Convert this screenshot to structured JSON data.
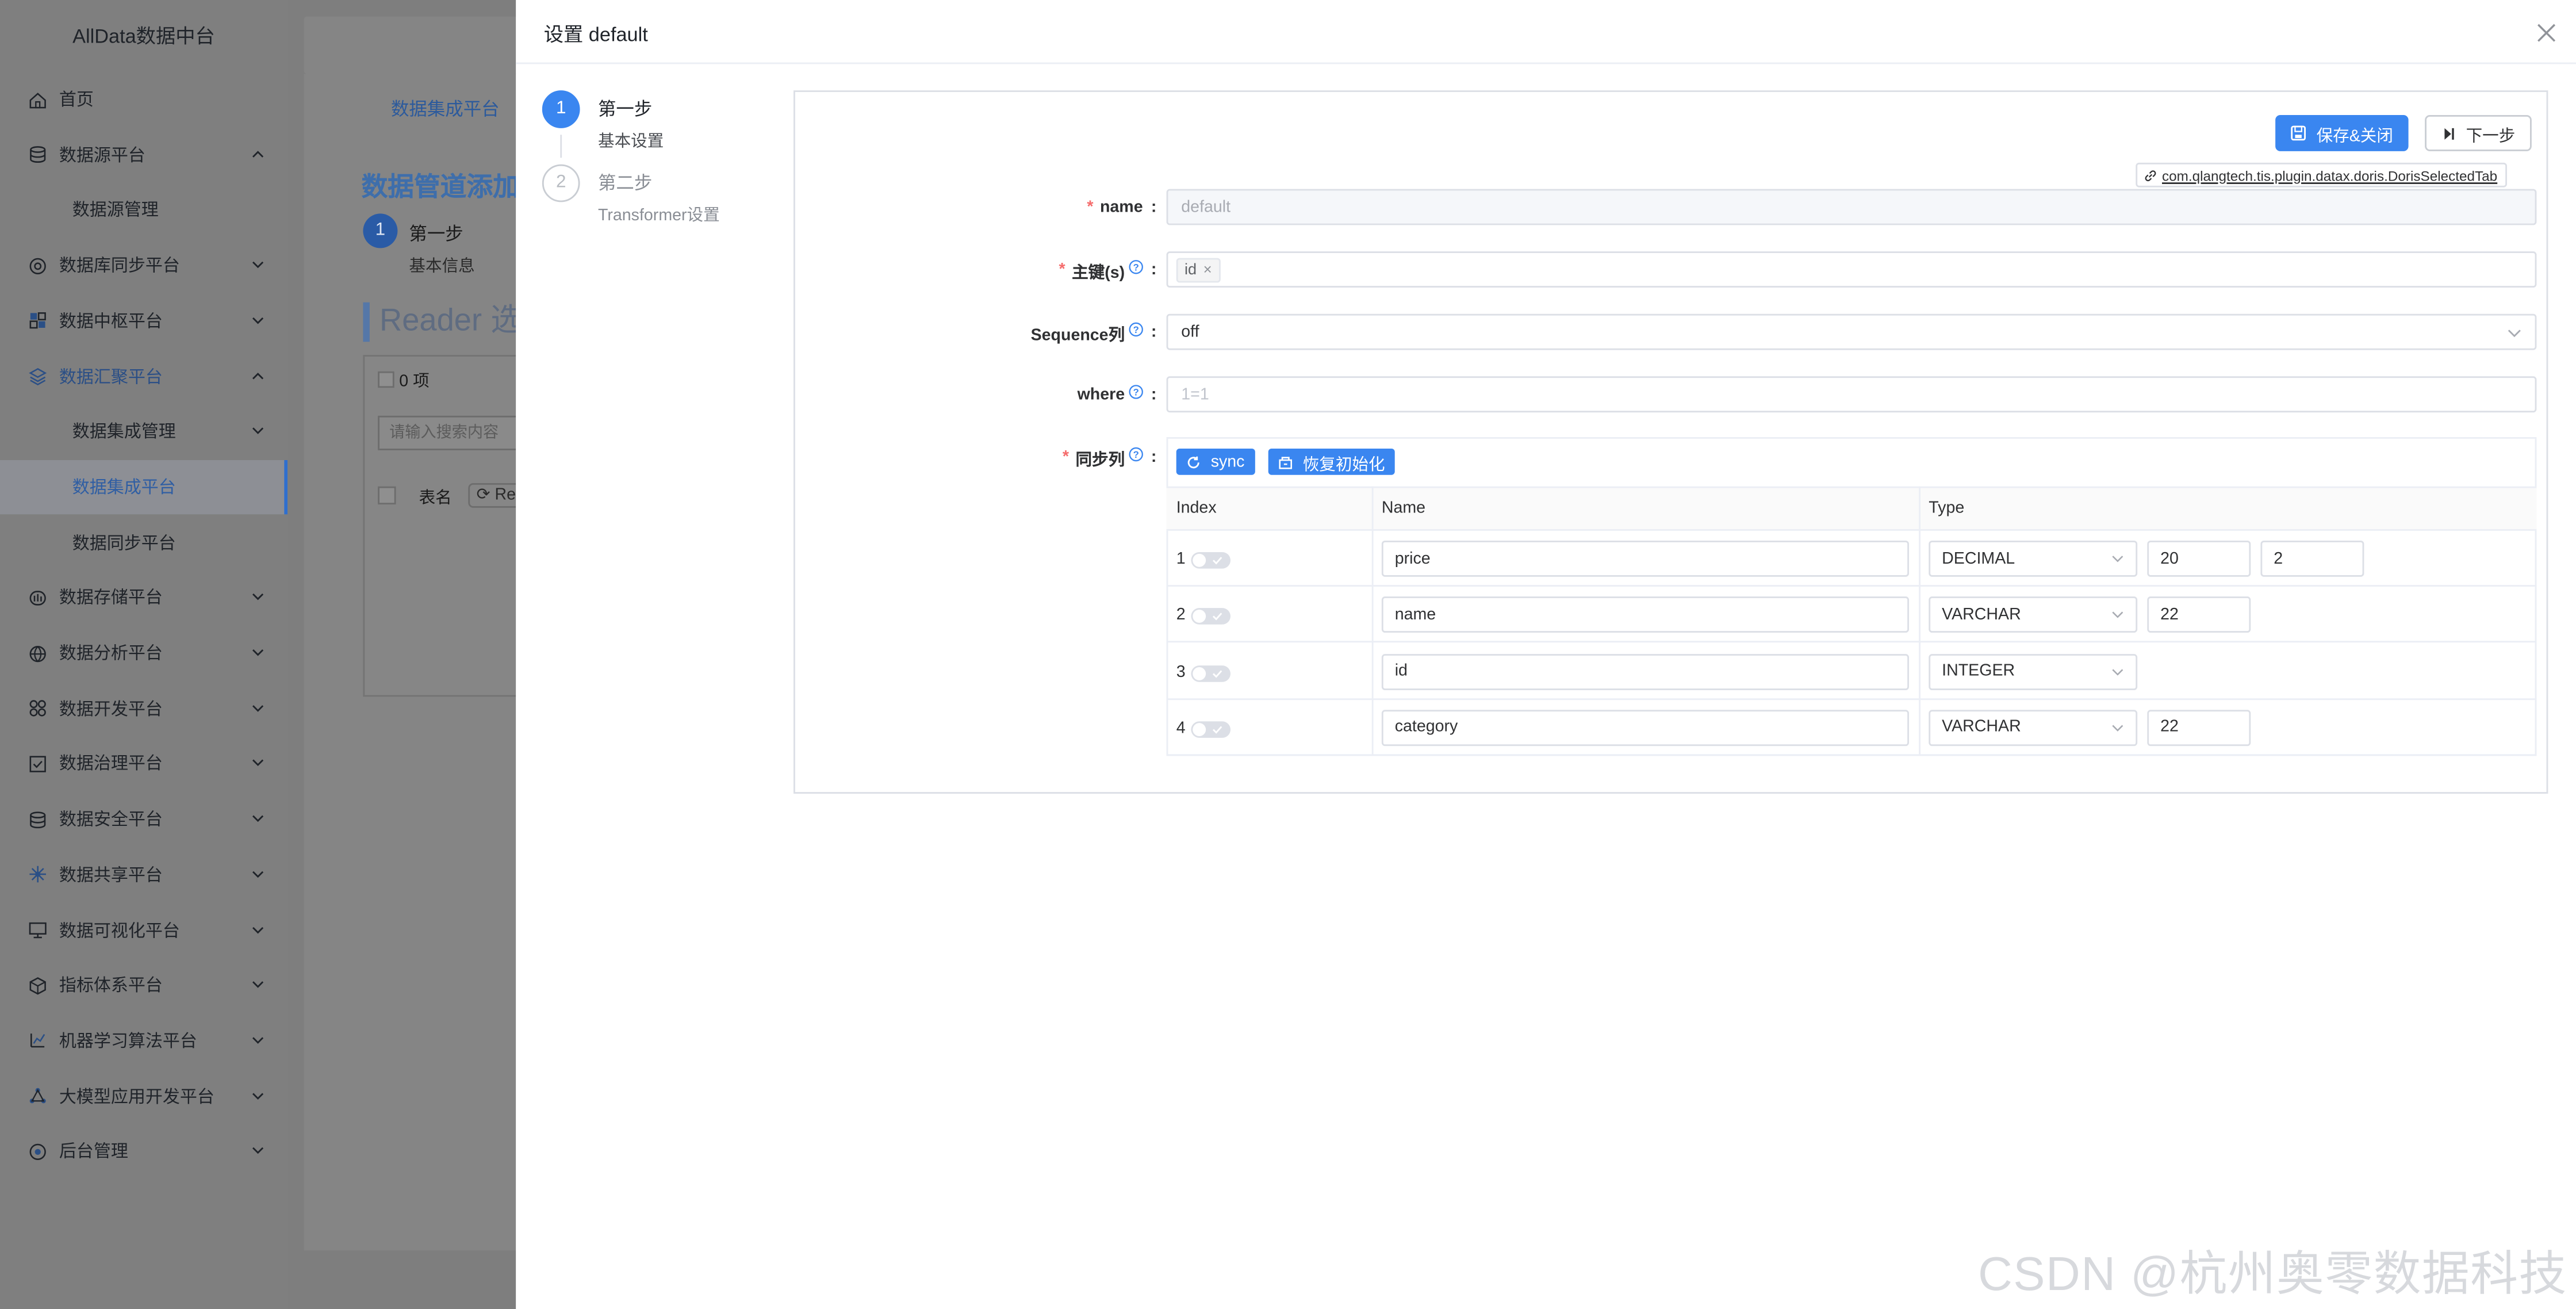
{
  "sidebar": {
    "logo": "AllData数据中台",
    "items": [
      {
        "label": "首页",
        "icon": "home-icon",
        "arrow": ""
      },
      {
        "label": "数据源平台",
        "icon": "database-icon",
        "arrow": "up"
      },
      {
        "label": "数据源管理",
        "sub": true,
        "arrow": ""
      },
      {
        "label": "数据库同步平台",
        "icon": "sync-db-icon",
        "arrow": "down"
      },
      {
        "label": "数据中枢平台",
        "icon": "hub-icon",
        "arrow": "down"
      },
      {
        "label": "数据汇聚平台",
        "icon": "layers-icon",
        "arrow": "up",
        "highlight": true
      },
      {
        "label": "数据集成管理",
        "sub": true,
        "arrow": "down"
      },
      {
        "label": "数据集成平台",
        "sub": true,
        "arrow": "",
        "active": true
      },
      {
        "label": "数据同步平台",
        "sub": true,
        "arrow": ""
      },
      {
        "label": "数据存储平台",
        "icon": "storage-icon",
        "arrow": "down"
      },
      {
        "label": "数据分析平台",
        "icon": "analysis-icon",
        "arrow": "down"
      },
      {
        "label": "数据开发平台",
        "icon": "dev-icon",
        "arrow": "down"
      },
      {
        "label": "数据治理平台",
        "icon": "governance-icon",
        "arrow": "down"
      },
      {
        "label": "数据安全平台",
        "icon": "security-icon",
        "arrow": "down"
      },
      {
        "label": "数据共享平台",
        "icon": "share-icon",
        "arrow": "down"
      },
      {
        "label": "数据可视化平台",
        "icon": "monitor-icon",
        "arrow": "down"
      },
      {
        "label": "指标体系平台",
        "icon": "metrics-icon",
        "arrow": "down"
      },
      {
        "label": "机器学习算法平台",
        "icon": "ml-icon",
        "arrow": "down"
      },
      {
        "label": "大模型应用开发平台",
        "icon": "llm-icon",
        "arrow": "down"
      },
      {
        "label": "后台管理",
        "icon": "admin-icon",
        "arrow": "down"
      }
    ]
  },
  "background": {
    "tab": "数据集成平台",
    "page_title": "数据管道添加",
    "step_number": "1",
    "step_title": "第一步",
    "step_desc": "基本信息",
    "section_title": "Reader 选",
    "count_label": "0 项",
    "search_placeholder": "请输入搜索内容",
    "table_col": "表名",
    "refresh_label": "Re"
  },
  "drawer": {
    "title": "设置 default",
    "steps": [
      {
        "number": "1",
        "title": "第一步",
        "desc": "基本设置",
        "status": "active"
      },
      {
        "number": "2",
        "title": "第二步",
        "desc": "Transformer设置",
        "status": "inactive"
      }
    ],
    "buttons": {
      "save_close": "保存&关闭",
      "next": "下一步"
    },
    "plugin_ref": "com.qlangtech.tis.plugin.datax.doris.DorisSelectedTab",
    "form": {
      "name": {
        "label": "name",
        "value": "default",
        "required": true
      },
      "primary_keys": {
        "label": "主键(s)",
        "tags": [
          "id"
        ],
        "required": true
      },
      "sequence": {
        "label": "Sequence列",
        "value": "off"
      },
      "where": {
        "label": "where",
        "placeholder": "1=1"
      },
      "sync_cols": {
        "label": "同步列",
        "required": true,
        "sync_button": "sync",
        "reset_button": "恢复初始化"
      }
    },
    "table": {
      "headers": [
        "Index",
        "Name",
        "Type"
      ],
      "rows": [
        {
          "index": "1",
          "name": "price",
          "type": "DECIMAL",
          "p1": "20",
          "p2": "2"
        },
        {
          "index": "2",
          "name": "name",
          "type": "VARCHAR",
          "p1": "22",
          "p2": ""
        },
        {
          "index": "3",
          "name": "id",
          "type": "INTEGER",
          "p1": "",
          "p2": ""
        },
        {
          "index": "4",
          "name": "category",
          "type": "VARCHAR",
          "p1": "22",
          "p2": ""
        }
      ]
    }
  },
  "watermark": "CSDN @杭州奥零数据科技"
}
